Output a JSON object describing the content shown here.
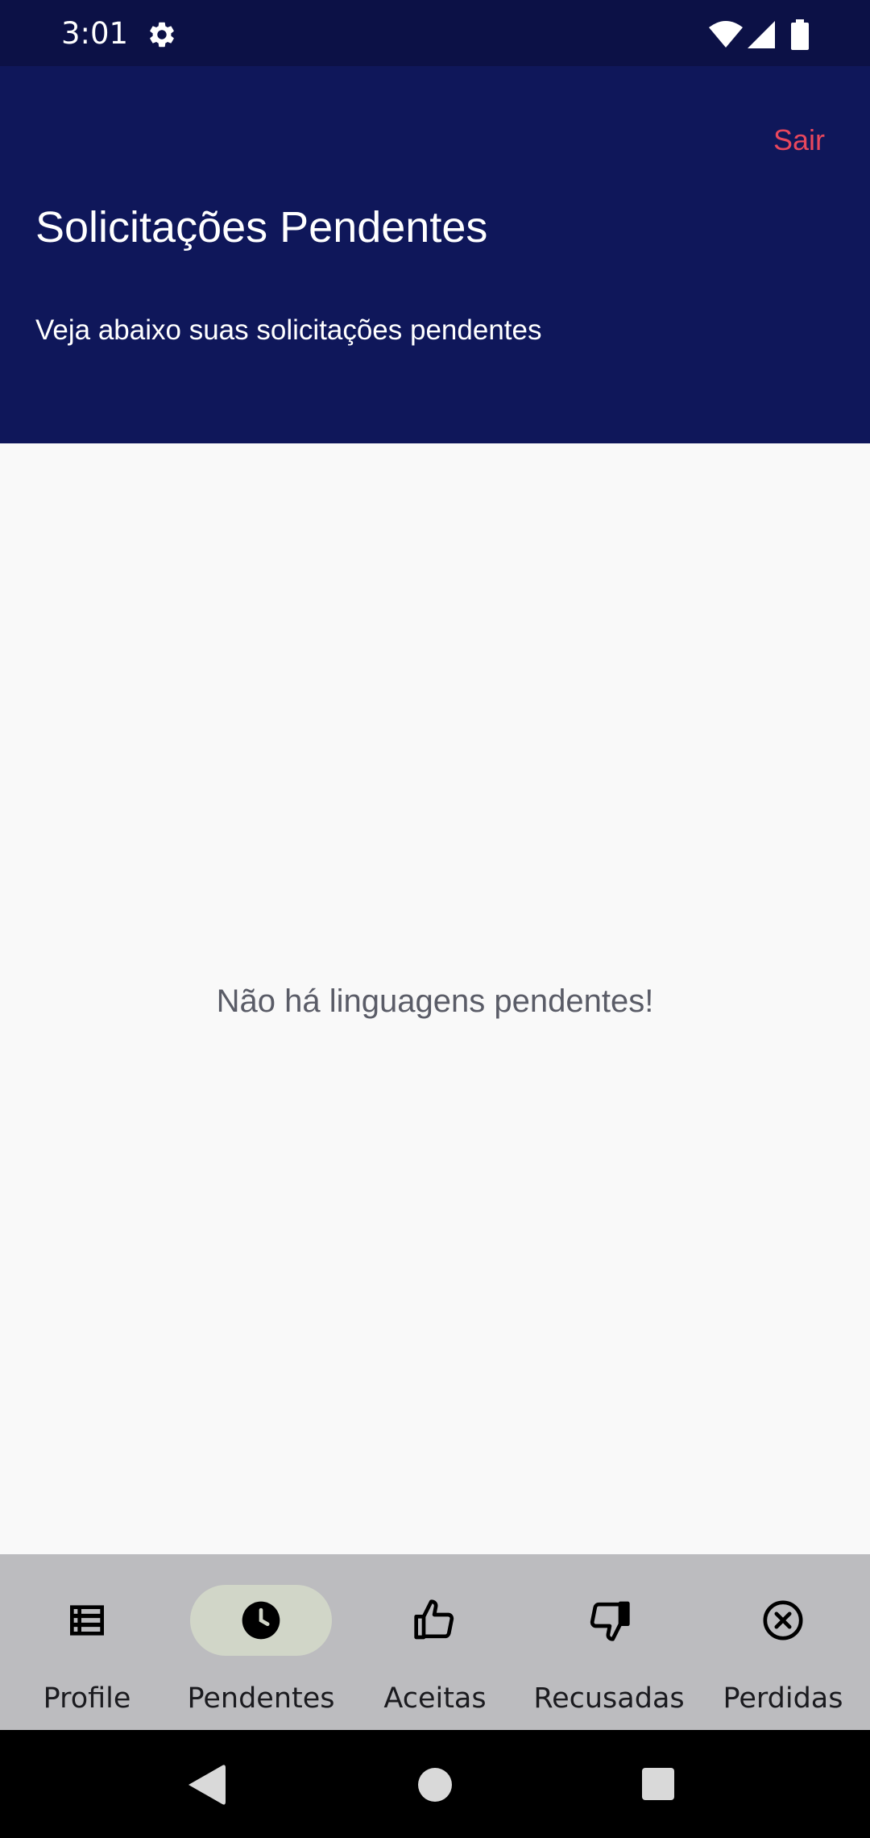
{
  "status_bar": {
    "time": "3:01",
    "icons": [
      "settings-gear-icon",
      "wifi-icon",
      "cell-signal-icon",
      "battery-icon"
    ]
  },
  "header": {
    "logout_label": "Sair",
    "title": "Solicitações Pendentes",
    "subtitle": "Veja abaixo suas solicitações pendentes",
    "background_color": "#0f175a",
    "logout_color": "#e8475d"
  },
  "main": {
    "empty_message": "Não há linguagens pendentes!"
  },
  "bottom_nav": {
    "items": [
      {
        "label": "Profile",
        "icon": "list-icon",
        "active": false
      },
      {
        "label": "Pendentes",
        "icon": "clock-icon",
        "active": true
      },
      {
        "label": "Aceitas",
        "icon": "thumbs-up-icon",
        "active": false
      },
      {
        "label": "Recusadas",
        "icon": "thumbs-down-icon",
        "active": false
      },
      {
        "label": "Perdidas",
        "icon": "cancel-circle-icon",
        "active": false
      }
    ],
    "active_pill_color": "#d1d6c8"
  },
  "system_nav": {
    "icons": [
      "back-icon",
      "home-icon",
      "recents-icon"
    ]
  }
}
